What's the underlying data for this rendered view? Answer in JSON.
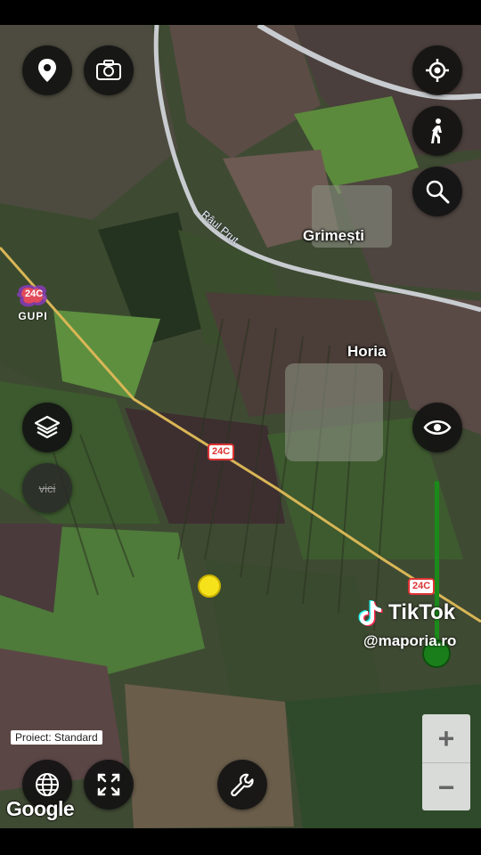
{
  "map": {
    "places": [
      {
        "name": "Grimești"
      },
      {
        "name": "Horia"
      }
    ],
    "river": "Râul Prut",
    "road_shields": [
      "24C",
      "24C"
    ],
    "provider": "Google"
  },
  "overlay": {
    "gupi_logo_text": "24C",
    "gupi_label": "GUPI",
    "project_label": "Proiect: Standard",
    "views_button_label": "vici"
  },
  "zoom": {
    "plus_label": "+",
    "minus_label": "−"
  },
  "watermark": {
    "brand": "TikTok",
    "handle": "@maporia.ro"
  },
  "colors": {
    "road": "#d9b656",
    "river": "#c8ccd0",
    "pin": "#f6e21a",
    "slider": "#1a8a1a"
  },
  "icons": {
    "top_left": [
      "location-pin-icon",
      "camera-icon"
    ],
    "right": [
      "my-location-icon",
      "pedestrian-icon",
      "search-icon",
      "eye-icon"
    ],
    "left": [
      "layers-icon",
      "vici-icon"
    ],
    "bottom": [
      "globe-icon",
      "fullscreen-icon",
      "wrench-icon"
    ]
  }
}
